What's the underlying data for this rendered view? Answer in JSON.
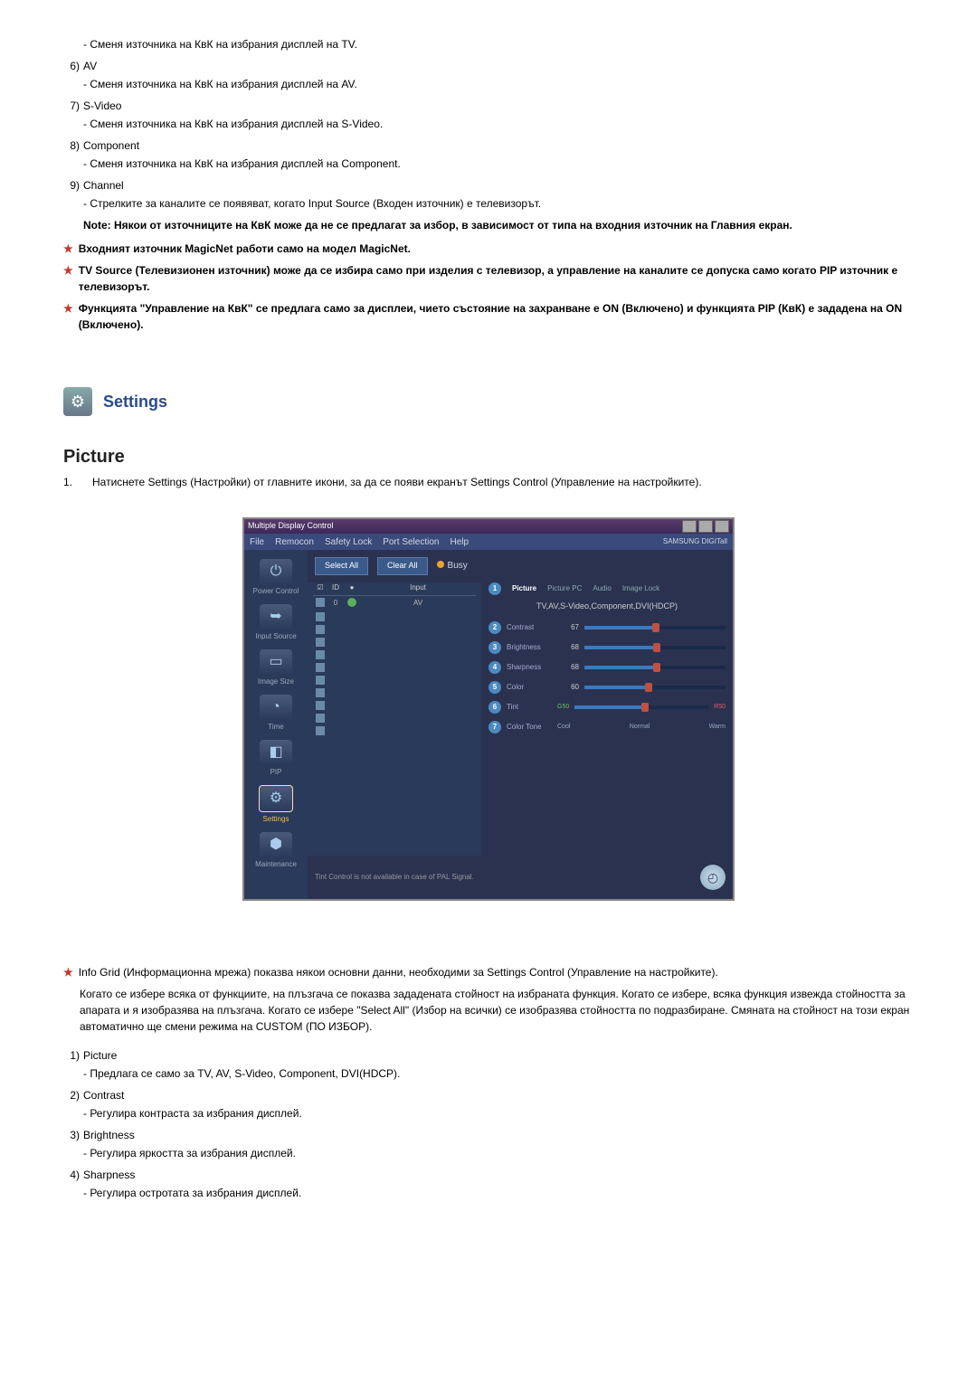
{
  "top_list": [
    {
      "num": "",
      "label": "",
      "sub": "- Сменя източника на КвК на избрания дисплей на TV."
    },
    {
      "num": "6)",
      "label": "AV",
      "sub": "- Сменя източника на КвК на избрания дисплей на AV."
    },
    {
      "num": "7)",
      "label": "S-Video",
      "sub": "- Сменя източника на КвК на избрания дисплей на S-Video."
    },
    {
      "num": "8)",
      "label": "Component",
      "sub": "- Сменя източника на КвК на избрания дисплей на Component."
    },
    {
      "num": "9)",
      "label": "Channel",
      "sub": "- Стрелките за каналите се появяват, когато Input Source (Входен източник) е телевизорът."
    }
  ],
  "note": "Note: Някои от източниците на КвК може да не се предлагат за избор, в зависимост от типа на входния източник на Главния екран.",
  "stars": [
    "Входният източник MagicNet работи само на модел MagicNet.",
    "TV Source (Телевизионен източник) може да се избира само при изделия с телевизор, а управление на каналите се допуска само когато PIP източник е телевизорът.",
    "Функцията \"Управление на КвК\" се предлага само за дисплеи, чието състояние на захранване е ON (Включено) и функцията PIP (КвК) е зададена на ON (Включено)."
  ],
  "section_title": "Settings",
  "picture_heading": "Picture",
  "picture_intro_num": "1.",
  "picture_intro": "Натиснете Settings (Настройки) от главните икони, за да се появи екранът Settings Control (Управление на настройките).",
  "screenshot": {
    "title": "Multiple Display Control",
    "menus": [
      "File",
      "Remocon",
      "Safety Lock",
      "Port Selection",
      "Help"
    ],
    "menu_right": "SAMSUNG DIGITall",
    "select_all": "Select All",
    "clear_all": "Clear All",
    "busy": "Busy",
    "sidebar": [
      {
        "label": "Power Control",
        "glyph": "⏻"
      },
      {
        "label": "Input Source",
        "glyph": "➥"
      },
      {
        "label": "Image Size",
        "glyph": "▭"
      },
      {
        "label": "Time",
        "glyph": "◔"
      },
      {
        "label": "PIP",
        "glyph": "◧"
      },
      {
        "label": "Settings",
        "glyph": "⚙"
      },
      {
        "label": "Maintenance",
        "glyph": "⬢"
      }
    ],
    "table_headers": {
      "c1": "☑",
      "c2": "ID",
      "c3": "●",
      "c4": "Input"
    },
    "table_rows": [
      {
        "id": "0",
        "input": "AV",
        "status": "green"
      },
      {
        "id": "",
        "input": "",
        "status": ""
      },
      {
        "id": "",
        "input": "",
        "status": ""
      },
      {
        "id": "",
        "input": "",
        "status": ""
      },
      {
        "id": "",
        "input": "",
        "status": ""
      },
      {
        "id": "",
        "input": "",
        "status": ""
      },
      {
        "id": "",
        "input": "",
        "status": ""
      },
      {
        "id": "",
        "input": "",
        "status": ""
      },
      {
        "id": "",
        "input": "",
        "status": ""
      },
      {
        "id": "",
        "input": "",
        "status": ""
      },
      {
        "id": "",
        "input": "",
        "status": ""
      }
    ],
    "tabs": [
      "Picture",
      "Picture PC",
      "Audio",
      "Image Lock"
    ],
    "mode_label": "TV,AV,S-Video,Component,DVI(HDCP)",
    "sliders": [
      {
        "n": "2",
        "label": "Contrast",
        "value": "67",
        "pct": 48
      },
      {
        "n": "3",
        "label": "Brightness",
        "value": "68",
        "pct": 49
      },
      {
        "n": "4",
        "label": "Sharpness",
        "value": "68",
        "pct": 49
      },
      {
        "n": "5",
        "label": "Color",
        "value": "60",
        "pct": 43
      }
    ],
    "tint": {
      "n": "6",
      "label": "Tint",
      "left": "G50",
      "right": "R50",
      "pct": 50
    },
    "color_tone": {
      "n": "7",
      "label": "Color Tone",
      "opts": [
        "Cool",
        "Normal",
        "Warm"
      ]
    },
    "footer": "Tint Control is not available in case of PAL Signal."
  },
  "info_star": "Info Grid (Информационна мрежа) показва някои основни данни, необходими за Settings Control (Управление на настройките).",
  "info_para": "Когато се избере всяка от функциите, на плъзгача се показва зададената стойност на избраната функция. Когато се избере, всяка функция извежда стойността за апарата и я изобразява на плъзгача. Когато се избере \"Select All\" (Избор на всички) се изобразява стойността по подразбиране. Смяната на стойност на този екран автоматично ще смени режима на CUSTOM (ПО ИЗБОР).",
  "bottom_list": [
    {
      "num": "1)",
      "label": "Picture",
      "sub": "- Предлага се само за TV, AV, S-Video, Component, DVI(HDCP)."
    },
    {
      "num": "2)",
      "label": "Contrast",
      "sub": "- Регулира контраста за избрания дисплей."
    },
    {
      "num": "3)",
      "label": "Brightness",
      "sub": "- Регулира яркостта за избрания дисплей."
    },
    {
      "num": "4)",
      "label": "Sharpness",
      "sub": "- Регулира остротата за избрания дисплей."
    }
  ]
}
